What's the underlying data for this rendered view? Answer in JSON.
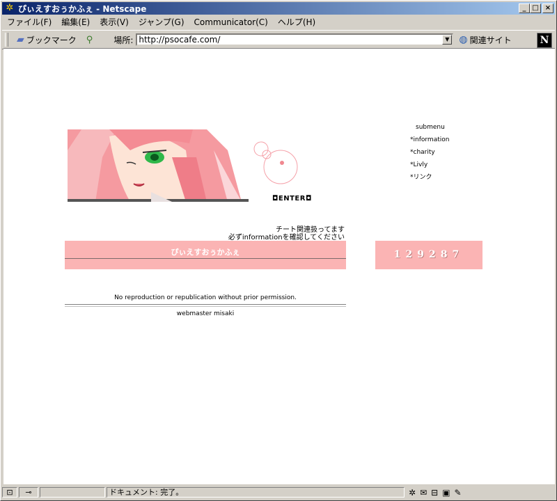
{
  "window": {
    "title": "ぴぃえすおぅかふぇ - Netscape"
  },
  "menubar": {
    "items": [
      "ファイル(F)",
      "編集(E)",
      "表示(V)",
      "ジャンプ(G)",
      "Communicator(C)",
      "ヘルプ(H)"
    ]
  },
  "toolbar": {
    "bookmarks_label": "ブックマーク",
    "location_label": "場所:",
    "url": "http://psocafe.com/",
    "related_label": "関連サイト"
  },
  "page": {
    "entero_label": "ENTER",
    "submenu": {
      "heading": "submenu",
      "items": [
        "*information",
        "*charity",
        "*Livly",
        "*リンク"
      ]
    },
    "notice_line1": "チート関連扱ってます",
    "notice_line2": "必ずinformationを確認してください",
    "site_title": "ぴぃえすおぅかふぇ",
    "counter": "129287",
    "copyright": "No reproduction or republication without prior permission.",
    "webmaster": "webmaster misaki"
  },
  "status": {
    "text": "ドキュメント: 完了。"
  },
  "colors": {
    "title_bar": "#0a246a",
    "pink_panel": "#fbb4b4",
    "chrome": "#d4d0c8"
  }
}
